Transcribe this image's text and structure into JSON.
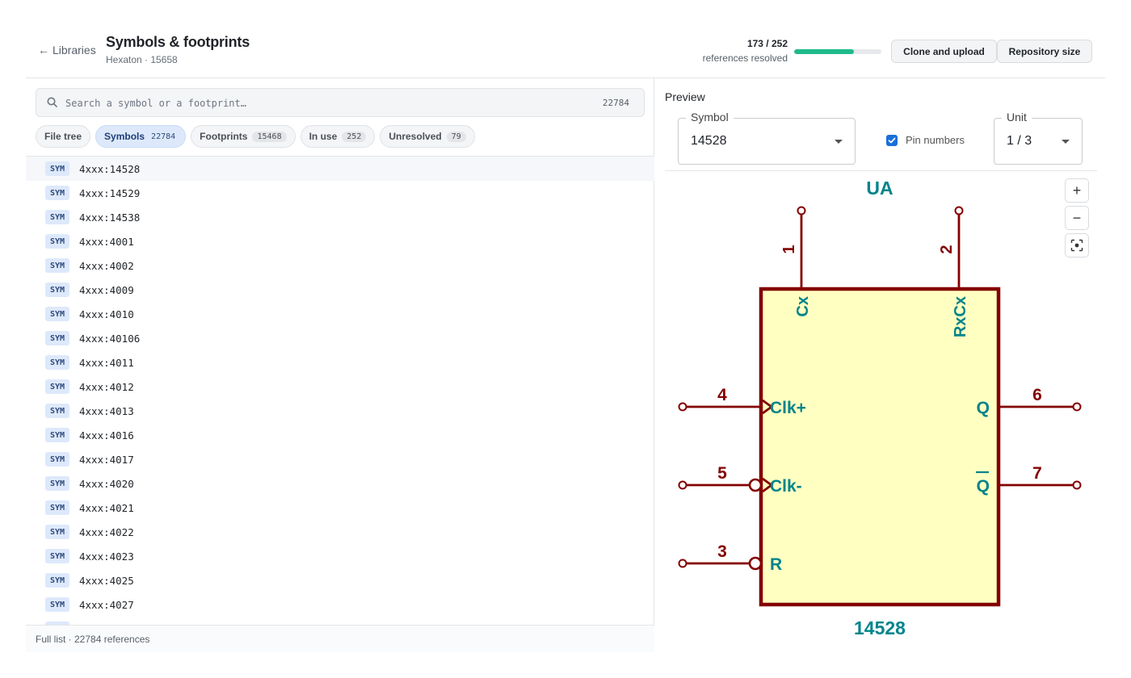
{
  "header": {
    "back_label": "Libraries",
    "title": "Symbols & footprints",
    "subtitle": "Hexaton · 15658",
    "progress": {
      "count": "173 / 252",
      "label": "references resolved",
      "fraction": 0.6865
    },
    "clone_button": "Clone and upload",
    "repo_button": "Repository size"
  },
  "search": {
    "placeholder": "Search a symbol or a footprint…",
    "value": "",
    "count": "22784"
  },
  "tabs": [
    {
      "label": "File tree",
      "count": ""
    },
    {
      "label": "Symbols",
      "count": "22784"
    },
    {
      "label": "Footprints",
      "count": "15468"
    },
    {
      "label": "In use",
      "count": "252"
    },
    {
      "label": "Unresolved",
      "count": "79"
    }
  ],
  "list": {
    "badge": "SYM",
    "items": [
      "4xxx:14528",
      "4xxx:14529",
      "4xxx:14538",
      "4xxx:4001",
      "4xxx:4002",
      "4xxx:4009",
      "4xxx:4010",
      "4xxx:40106",
      "4xxx:4011",
      "4xxx:4012",
      "4xxx:4013",
      "4xxx:4016",
      "4xxx:4017",
      "4xxx:4020",
      "4xxx:4021",
      "4xxx:4022",
      "4xxx:4023",
      "4xxx:4025",
      "4xxx:4027"
    ]
  },
  "footer": "Full list · 22784 references",
  "preview": {
    "title": "Preview",
    "symbol_label": "Symbol",
    "symbol_value": "14528",
    "pin_numbers_label": "Pin numbers",
    "pin_numbers_checked": true,
    "unit_label": "Unit",
    "unit_value": "1 / 3",
    "zoom_in": "+",
    "zoom_out": "−"
  },
  "schematic": {
    "reference": "UA",
    "value": "14528",
    "pins": {
      "p1": {
        "number": "1",
        "name": "Cx"
      },
      "p2": {
        "number": "2",
        "name": "RxCx"
      },
      "p4": {
        "number": "4",
        "name": "Clk+"
      },
      "p5": {
        "number": "5",
        "name": "Clk-"
      },
      "p3": {
        "number": "3",
        "name": "R"
      },
      "p6": {
        "number": "6",
        "name": "Q"
      },
      "p7": {
        "number": "7",
        "name": "Q"
      }
    },
    "colors": {
      "outline": "#840000",
      "body_fill": "#ffffc2",
      "text": "#00848a"
    }
  }
}
